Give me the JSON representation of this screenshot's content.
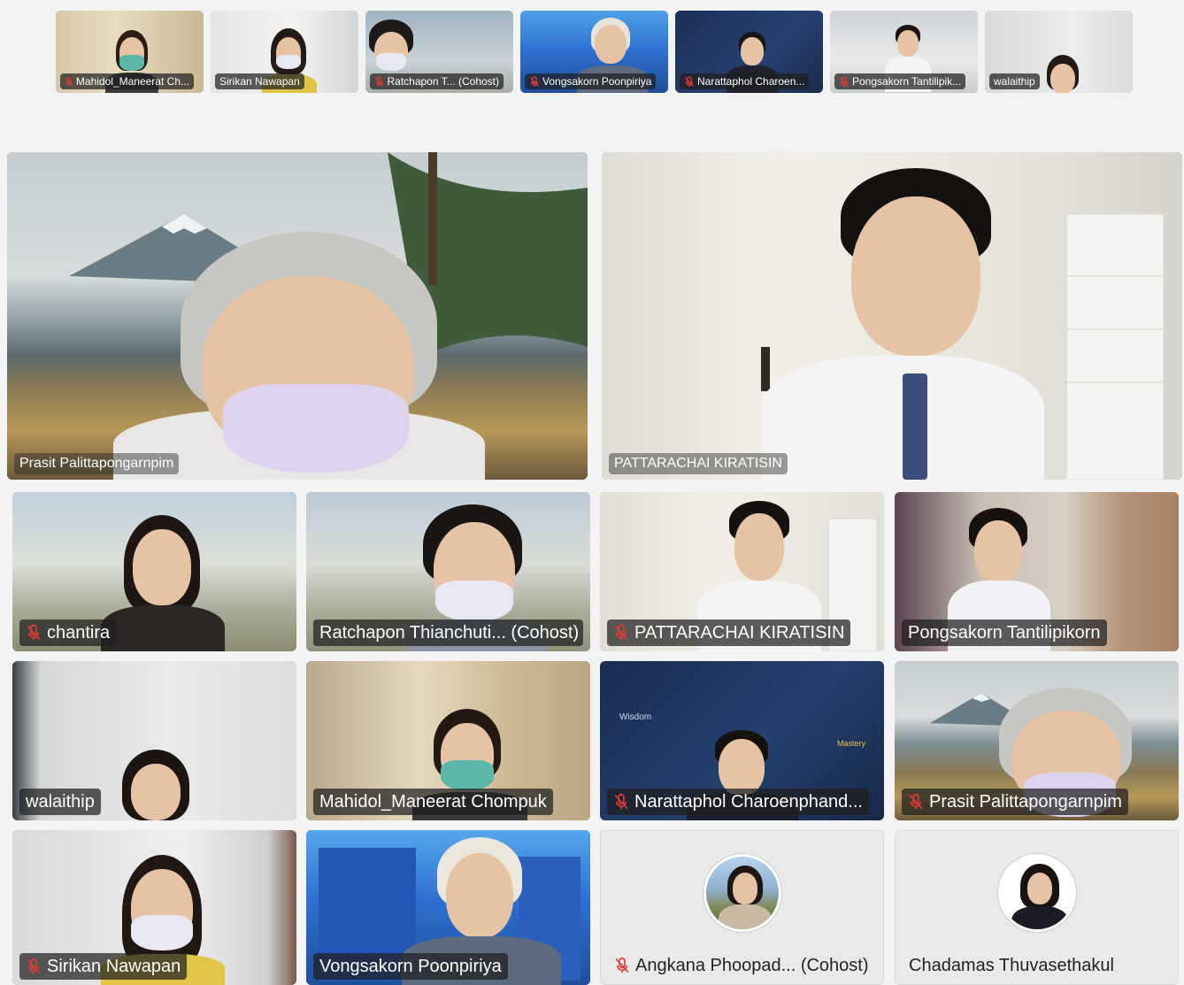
{
  "strip": [
    {
      "name": "Mahidol_Maneerat Ch...",
      "muted": true
    },
    {
      "name": "Sirikan Nawapan",
      "muted": false
    },
    {
      "name": "Ratchapon T... (Cohost)",
      "muted": true
    },
    {
      "name": "Vongsakorn Poonpiriya",
      "muted": true
    },
    {
      "name": "Narattaphol Charoen...",
      "muted": true
    },
    {
      "name": "Pongsakorn Tantilipik...",
      "muted": true
    },
    {
      "name": "walaithip",
      "muted": false
    }
  ],
  "featured": [
    {
      "name": "Prasit Palittapongarnpim",
      "muted": false
    },
    {
      "name": "PATTARACHAI KIRATISIN",
      "muted": false
    }
  ],
  "grid": [
    {
      "name": "chantira",
      "muted": true
    },
    {
      "name": "Ratchapon Thianchuti... (Cohost)",
      "muted": false
    },
    {
      "name": "PATTARACHAI KIRATISIN",
      "muted": true
    },
    {
      "name": "Pongsakorn Tantilipikorn",
      "muted": false
    },
    {
      "name": "walaithip",
      "muted": false
    },
    {
      "name": "Mahidol_Maneerat Chompuk",
      "muted": false
    },
    {
      "name": "Narattaphol Charoenphand...",
      "muted": true
    },
    {
      "name": "Prasit Palittapongarnpim",
      "muted": true
    },
    {
      "name": "Sirikan Nawapan",
      "muted": true
    },
    {
      "name": "Vongsakorn Poonpiriya",
      "muted": false
    },
    {
      "name": "Angkana Phoopad... (Cohost)",
      "muted": true
    },
    {
      "name": "Chadamas Thuvasethakul",
      "muted": false
    }
  ],
  "icons": {
    "muted": "mic-off-icon"
  },
  "colors": {
    "mic_off": "#e53935",
    "selected_outline": "#1e63c9",
    "label_bg": "#1e1e1e"
  }
}
